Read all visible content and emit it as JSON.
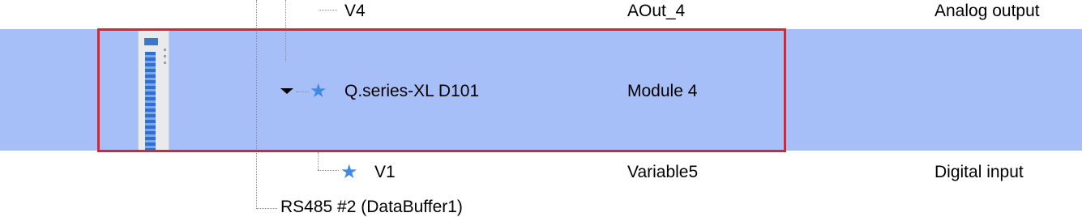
{
  "rows": [
    {
      "name": "V4",
      "id": "AOut_4",
      "type": "Analog output"
    },
    {
      "name": "Q.series-XL D101",
      "id": "Module 4",
      "type": ""
    },
    {
      "name": "V1",
      "id": "Variable5",
      "type": "Digital input"
    },
    {
      "name": "RS485 #2 (DataBuffer1)"
    }
  ],
  "colors": {
    "selection": "#a7bff8",
    "highlight": "#e0222c",
    "star": "#3d8be6"
  },
  "icons": {
    "module": "io-module-icon",
    "star": "star-icon",
    "expand": "collapse-arrow-icon"
  }
}
